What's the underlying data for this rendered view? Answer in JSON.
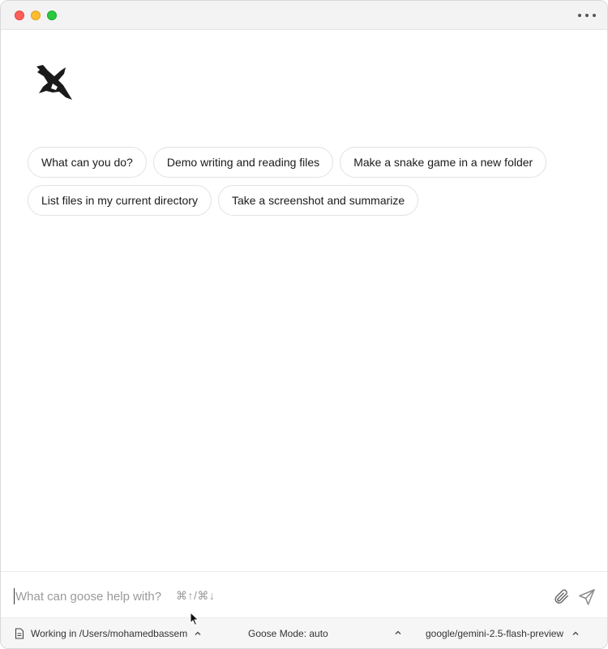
{
  "window": {
    "title": "",
    "controls": [
      "close",
      "minimize",
      "maximize"
    ],
    "menu_icon": "more-horizontal-icon"
  },
  "logo": {
    "icon": "goose-logo-icon"
  },
  "suggestions": {
    "row1": [
      "What can you do?",
      "Demo writing and reading files",
      "Make a snake game in a new folder"
    ],
    "row2": [
      "List files in my current directory",
      "Take a screenshot and summarize"
    ]
  },
  "composer": {
    "placeholder": "What can goose help with?",
    "value": "",
    "shortcut_hint": "⌘↑/⌘↓",
    "attach_icon": "paperclip-icon",
    "send_icon": "send-icon"
  },
  "status": {
    "directory_label": "Working in /Users/mohamedbassem",
    "mode_label": "Goose Mode: auto",
    "model_label": "google/gemini-2.5-flash-preview"
  },
  "colors": {
    "close": "#ff5f57",
    "minimize": "#febc2e",
    "maximize": "#28c840",
    "chip_border": "#e2e2e2",
    "placeholder": "#9a9a9a"
  }
}
